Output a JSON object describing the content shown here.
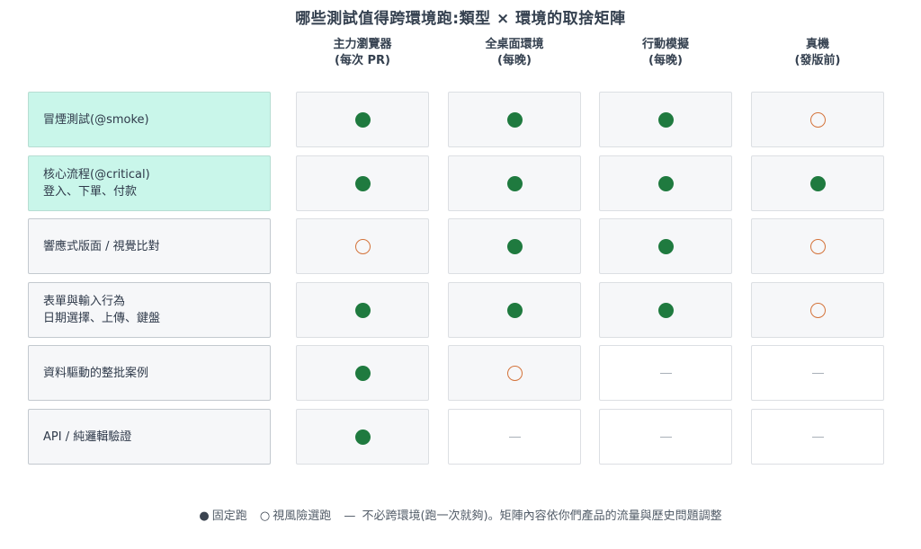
{
  "title": "哪些測試值得跨環境跑:類型 × 環境的取捨矩陣",
  "columns": [
    {
      "name": "主力瀏覽器",
      "sub": "(每次 PR)"
    },
    {
      "name": "全桌面環境",
      "sub": "(每晚)"
    },
    {
      "name": "行動模擬",
      "sub": "(每晚)"
    },
    {
      "name": "真機",
      "sub": "(發版前)"
    }
  ],
  "rows": [
    {
      "lines": [
        "冒煙測試(@smoke)"
      ],
      "highlight": true,
      "marks": [
        "fixed",
        "fixed",
        "fixed",
        "risk"
      ]
    },
    {
      "lines": [
        "核心流程(@critical)",
        "登入、下單、付款"
      ],
      "highlight": true,
      "marks": [
        "fixed",
        "fixed",
        "fixed",
        "fixed"
      ]
    },
    {
      "lines": [
        "響應式版面 / 視覺比對"
      ],
      "highlight": false,
      "marks": [
        "risk",
        "fixed",
        "fixed",
        "risk"
      ]
    },
    {
      "lines": [
        "表單與輸入行為",
        "日期選擇、上傳、鍵盤"
      ],
      "highlight": false,
      "marks": [
        "fixed",
        "fixed",
        "fixed",
        "risk"
      ]
    },
    {
      "lines": [
        "資料驅動的整批案例"
      ],
      "highlight": false,
      "marks": [
        "fixed",
        "risk",
        "none",
        "none"
      ]
    },
    {
      "lines": [
        "API / 純邏輯驗證"
      ],
      "highlight": false,
      "marks": [
        "fixed",
        "none",
        "none",
        "none"
      ]
    }
  ],
  "legend": {
    "fixed_glyph": "●",
    "fixed_label": "固定跑",
    "risk_glyph": "○",
    "risk_label": "視風險選跑",
    "none_glyph": "—",
    "none_label": "不必跨環境(跑一次就夠)。矩陣內容依你們產品的流量與歷史問題調整"
  },
  "colors": {
    "fixed": "#1f7a3f",
    "risk": "#d4733a",
    "none": "#a9b0b8",
    "highlight_row": "#c9f6ea"
  }
}
